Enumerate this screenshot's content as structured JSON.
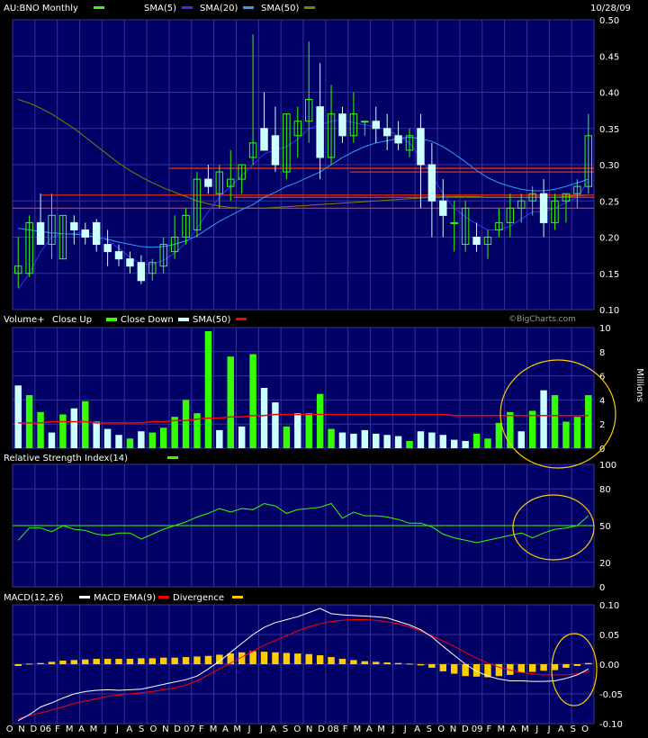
{
  "chart_data": [
    {
      "panel": "price",
      "type": "candlestick",
      "title": "AU:BNO Monthly",
      "date": "10/28/09",
      "legend": [
        {
          "label": "SMA(5)",
          "color": "#3333ff"
        },
        {
          "label": "SMA(20)",
          "color": "#3399ff"
        },
        {
          "label": "SMA(50)",
          "color": "#808000"
        }
      ],
      "title_swatch": "#33ff00",
      "ylim": [
        0.1,
        0.5
      ],
      "yticks": [
        "0.50",
        "0.45",
        "0.40",
        "0.35",
        "0.30",
        "0.25",
        "0.20",
        "0.15",
        "0.10"
      ],
      "ytick_values": [
        0.5,
        0.45,
        0.4,
        0.35,
        0.3,
        0.25,
        0.2,
        0.15,
        0.1
      ],
      "watermark": "©BigCharts.com",
      "months": [
        "O",
        "N",
        "D",
        "06",
        "F",
        "M",
        "A",
        "M",
        "J",
        "J",
        "A",
        "S",
        "O",
        "N",
        "D",
        "07",
        "F",
        "M",
        "A",
        "M",
        "J",
        "J",
        "A",
        "S",
        "O",
        "N",
        "D",
        "08",
        "F",
        "M",
        "A",
        "M",
        "J",
        "J",
        "A",
        "S",
        "O",
        "N",
        "D",
        "09",
        "F",
        "M",
        "A",
        "M",
        "J",
        "J",
        "A",
        "S",
        "O"
      ],
      "candles": [
        [
          0.15,
          0.2,
          0.13,
          0.16
        ],
        [
          0.15,
          0.23,
          0.145,
          0.22
        ],
        [
          0.22,
          0.26,
          0.19,
          0.19
        ],
        [
          0.19,
          0.26,
          0.17,
          0.23
        ],
        [
          0.17,
          0.23,
          0.17,
          0.23
        ],
        [
          0.22,
          0.23,
          0.19,
          0.21
        ],
        [
          0.21,
          0.22,
          0.19,
          0.2
        ],
        [
          0.22,
          0.225,
          0.18,
          0.19
        ],
        [
          0.19,
          0.21,
          0.16,
          0.18
        ],
        [
          0.18,
          0.19,
          0.16,
          0.17
        ],
        [
          0.17,
          0.18,
          0.15,
          0.16
        ],
        [
          0.165,
          0.175,
          0.135,
          0.14
        ],
        [
          0.15,
          0.17,
          0.14,
          0.165
        ],
        [
          0.16,
          0.2,
          0.15,
          0.19
        ],
        [
          0.18,
          0.23,
          0.17,
          0.2
        ],
        [
          0.2,
          0.24,
          0.19,
          0.23
        ],
        [
          0.21,
          0.29,
          0.2,
          0.28
        ],
        [
          0.28,
          0.3,
          0.26,
          0.27
        ],
        [
          0.26,
          0.3,
          0.24,
          0.29
        ],
        [
          0.27,
          0.32,
          0.25,
          0.28
        ],
        [
          0.28,
          0.3,
          0.26,
          0.3
        ],
        [
          0.31,
          0.48,
          0.3,
          0.33
        ],
        [
          0.35,
          0.4,
          0.32,
          0.32
        ],
        [
          0.34,
          0.38,
          0.29,
          0.3
        ],
        [
          0.29,
          0.37,
          0.28,
          0.37
        ],
        [
          0.34,
          0.38,
          0.31,
          0.36
        ],
        [
          0.36,
          0.47,
          0.33,
          0.39
        ],
        [
          0.38,
          0.44,
          0.28,
          0.31
        ],
        [
          0.31,
          0.41,
          0.3,
          0.37
        ],
        [
          0.37,
          0.38,
          0.33,
          0.34
        ],
        [
          0.34,
          0.4,
          0.33,
          0.37
        ],
        [
          0.36,
          0.36,
          0.34,
          0.36
        ],
        [
          0.36,
          0.38,
          0.33,
          0.35
        ],
        [
          0.35,
          0.37,
          0.32,
          0.34
        ],
        [
          0.34,
          0.36,
          0.32,
          0.33
        ],
        [
          0.32,
          0.35,
          0.31,
          0.34
        ],
        [
          0.35,
          0.37,
          0.24,
          0.3
        ],
        [
          0.3,
          0.33,
          0.2,
          0.25
        ],
        [
          0.25,
          0.28,
          0.2,
          0.23
        ],
        [
          0.22,
          0.25,
          0.18,
          0.22
        ],
        [
          0.19,
          0.25,
          0.18,
          0.24
        ],
        [
          0.2,
          0.22,
          0.18,
          0.19
        ],
        [
          0.19,
          0.21,
          0.17,
          0.2
        ],
        [
          0.21,
          0.24,
          0.2,
          0.22
        ],
        [
          0.22,
          0.26,
          0.2,
          0.24
        ],
        [
          0.24,
          0.26,
          0.22,
          0.25
        ],
        [
          0.25,
          0.27,
          0.23,
          0.26
        ],
        [
          0.26,
          0.28,
          0.2,
          0.22
        ],
        [
          0.22,
          0.26,
          0.21,
          0.25
        ],
        [
          0.25,
          0.26,
          0.22,
          0.26
        ],
        [
          0.26,
          0.28,
          0.24,
          0.27
        ],
        [
          0.27,
          0.37,
          0.26,
          0.34
        ]
      ],
      "sma5": [
        0.128,
        0.15,
        0.18,
        0.2,
        0.205,
        0.205,
        0.207,
        0.203,
        0.195,
        0.185,
        0.172,
        0.163,
        0.162,
        0.168,
        0.178,
        0.192,
        0.212,
        0.235,
        0.255,
        0.27,
        0.285,
        0.3,
        0.315,
        0.32,
        0.325,
        0.335,
        0.35,
        0.355,
        0.36,
        0.362,
        0.358,
        0.355,
        0.352,
        0.348,
        0.34,
        0.33,
        0.31,
        0.285,
        0.26,
        0.24,
        0.228,
        0.218,
        0.21,
        0.21,
        0.215,
        0.225,
        0.235,
        0.235,
        0.24,
        0.248,
        0.255,
        0.278
      ],
      "sma20": [
        0.212,
        0.21,
        0.208,
        0.206,
        0.205,
        0.204,
        0.203,
        0.2,
        0.197,
        0.193,
        0.19,
        0.187,
        0.186,
        0.187,
        0.19,
        0.195,
        0.202,
        0.212,
        0.222,
        0.23,
        0.238,
        0.245,
        0.255,
        0.262,
        0.27,
        0.276,
        0.283,
        0.29,
        0.3,
        0.31,
        0.318,
        0.325,
        0.33,
        0.333,
        0.336,
        0.338,
        0.336,
        0.332,
        0.325,
        0.315,
        0.304,
        0.292,
        0.282,
        0.275,
        0.27,
        0.266,
        0.264,
        0.264,
        0.266,
        0.27,
        0.275,
        0.28
      ],
      "sma50": [
        0.39,
        0.385,
        0.378,
        0.37,
        0.36,
        0.35,
        0.338,
        0.326,
        0.314,
        0.302,
        0.292,
        0.283,
        0.275,
        0.268,
        0.262,
        0.256,
        0.25,
        0.246,
        0.243,
        0.241,
        0.24,
        0.24,
        0.24,
        0.241,
        0.242,
        0.243,
        0.244,
        0.245,
        0.246,
        0.247,
        0.248,
        0.249,
        0.25,
        0.251,
        0.252,
        0.253,
        0.254,
        0.255,
        0.256,
        0.256,
        0.256,
        0.256,
        0.255,
        0.255,
        0.255,
        0.255,
        0.255,
        0.255,
        0.255,
        0.256,
        0.257,
        0.258
      ],
      "hlines": [
        {
          "value": 0.295,
          "from": 0.27,
          "to": 1.0,
          "color": "#ff3300"
        },
        {
          "value": 0.29,
          "from": 0.58,
          "to": 1.0,
          "color": "#ff3300"
        },
        {
          "value": 0.258,
          "from": 0.05,
          "to": 1.0,
          "color": "#ff3300"
        },
        {
          "value": 0.255,
          "from": 0.38,
          "to": 1.0,
          "color": "#ff3300"
        },
        {
          "value": 0.24,
          "from": 0.0,
          "to": 1.0,
          "color": "#ff3300"
        }
      ]
    },
    {
      "panel": "volume",
      "type": "bar",
      "legend_text": [
        "Volume+",
        "Close Up",
        "Close Down",
        "SMA(50)"
      ],
      "legend_colors": {
        "up": "#33ff00",
        "down": "#ccffff",
        "sma": "#ff0000"
      },
      "units": "Millions",
      "ylim": [
        0,
        10
      ],
      "yticks": [
        "10",
        "8",
        "6",
        "4",
        "2",
        "0"
      ],
      "ytick_values": [
        10,
        8,
        6,
        4,
        2,
        0
      ],
      "values": [
        5.2,
        4.4,
        3.0,
        1.3,
        2.8,
        3.3,
        3.9,
        2.2,
        1.6,
        1.1,
        0.8,
        1.4,
        1.3,
        1.7,
        2.6,
        4.0,
        2.9,
        9.7,
        1.5,
        7.6,
        1.8,
        7.8,
        5.0,
        3.8,
        1.8,
        2.9,
        2.9,
        4.5,
        1.6,
        1.3,
        1.2,
        1.5,
        1.2,
        1.1,
        1.0,
        0.6,
        1.4,
        1.3,
        1.1,
        0.7,
        0.6,
        1.2,
        0.8,
        2.1,
        3.0,
        1.4,
        3.1,
        4.8,
        4.4,
        2.2,
        2.6,
        4.4
      ],
      "up": [
        false,
        true,
        true,
        false,
        true,
        false,
        true,
        false,
        false,
        false,
        true,
        false,
        true,
        true,
        true,
        true,
        true,
        true,
        false,
        true,
        false,
        true,
        false,
        false,
        true,
        false,
        true,
        true,
        true,
        false,
        false,
        false,
        false,
        false,
        false,
        true,
        false,
        false,
        false,
        false,
        false,
        true,
        true,
        true,
        true,
        false,
        true,
        false,
        true,
        true,
        true,
        true
      ],
      "sma": [
        2.1,
        2.1,
        2.1,
        2.2,
        2.2,
        2.2,
        2.2,
        2.1,
        2.1,
        2.1,
        2.1,
        2.1,
        2.2,
        2.2,
        2.3,
        2.3,
        2.4,
        2.5,
        2.5,
        2.6,
        2.6,
        2.7,
        2.7,
        2.8,
        2.8,
        2.8,
        2.8,
        2.8,
        2.8,
        2.8,
        2.8,
        2.8,
        2.8,
        2.8,
        2.8,
        2.8,
        2.8,
        2.8,
        2.8,
        2.7,
        2.7,
        2.7,
        2.7,
        2.7,
        2.7,
        2.7,
        2.7,
        2.7,
        2.7,
        2.7,
        2.7,
        2.7
      ]
    },
    {
      "panel": "rsi",
      "type": "line",
      "title": "Relative Strength Index(14)",
      "title_swatch": "#33ff00",
      "ylim": [
        0,
        100
      ],
      "yticks": [
        "100",
        "80",
        "50",
        "20",
        "0"
      ],
      "ytick_values": [
        100,
        80,
        50,
        20,
        0
      ],
      "midline": 50,
      "values": [
        38,
        48,
        48,
        45,
        50,
        47,
        46,
        43,
        42,
        44,
        44,
        39,
        43,
        47,
        50,
        53,
        57,
        60,
        64,
        61,
        64,
        63,
        68,
        66,
        60,
        63,
        64,
        65,
        68,
        56,
        61,
        58,
        58,
        57,
        55,
        52,
        52,
        49,
        43,
        40,
        38,
        36,
        38,
        40,
        42,
        44,
        40,
        44,
        47,
        48,
        50,
        58
      ]
    },
    {
      "panel": "macd",
      "type": "line+bar",
      "legend_text": [
        "MACD(12,26)",
        "MACD EMA(9)",
        "Divergence"
      ],
      "legend_colors": {
        "macd": "#ffffff",
        "ema": "#ff0000",
        "div": "#ffcc00"
      },
      "ylim": [
        -0.1,
        0.1
      ],
      "yticks": [
        "0.10",
        "0.05",
        "0.00",
        "-0.05",
        "-0.10"
      ],
      "ytick_values": [
        0.1,
        0.05,
        0.0,
        -0.05,
        -0.1
      ],
      "macd": [
        -0.095,
        -0.085,
        -0.072,
        -0.065,
        -0.057,
        -0.05,
        -0.046,
        -0.044,
        -0.043,
        -0.044,
        -0.043,
        -0.042,
        -0.038,
        -0.034,
        -0.03,
        -0.026,
        -0.02,
        -0.008,
        0.005,
        0.02,
        0.035,
        0.05,
        0.062,
        0.07,
        0.075,
        0.08,
        0.087,
        0.094,
        0.085,
        0.083,
        0.082,
        0.081,
        0.08,
        0.078,
        0.072,
        0.066,
        0.058,
        0.046,
        0.03,
        0.015,
        0.0,
        -0.012,
        -0.02,
        -0.025,
        -0.028,
        -0.028,
        -0.029,
        -0.029,
        -0.028,
        -0.024,
        -0.018,
        -0.008
      ],
      "ema": [
        -0.092,
        -0.086,
        -0.082,
        -0.077,
        -0.072,
        -0.066,
        -0.062,
        -0.058,
        -0.054,
        -0.052,
        -0.05,
        -0.048,
        -0.046,
        -0.043,
        -0.04,
        -0.035,
        -0.028,
        -0.018,
        -0.008,
        0.002,
        0.012,
        0.022,
        0.032,
        0.04,
        0.048,
        0.056,
        0.063,
        0.068,
        0.072,
        0.074,
        0.075,
        0.075,
        0.074,
        0.071,
        0.068,
        0.063,
        0.056,
        0.048,
        0.039,
        0.03,
        0.02,
        0.01,
        0.002,
        -0.005,
        -0.01,
        -0.014,
        -0.016,
        -0.018,
        -0.018,
        -0.018,
        -0.016,
        -0.012
      ],
      "div": [
        -0.003,
        0.001,
        0.002,
        0.004,
        0.006,
        0.007,
        0.008,
        0.009,
        0.009,
        0.009,
        0.009,
        0.01,
        0.01,
        0.011,
        0.011,
        0.012,
        0.013,
        0.014,
        0.016,
        0.018,
        0.02,
        0.022,
        0.021,
        0.02,
        0.019,
        0.018,
        0.017,
        0.015,
        0.012,
        0.009,
        0.007,
        0.005,
        0.004,
        0.003,
        0.002,
        0.001,
        -0.002,
        -0.006,
        -0.012,
        -0.016,
        -0.02,
        -0.021,
        -0.022,
        -0.02,
        -0.018,
        -0.014,
        -0.013,
        -0.011,
        -0.01,
        -0.006,
        -0.003,
        0.002
      ]
    }
  ],
  "highlight_color": "#ffcc00"
}
